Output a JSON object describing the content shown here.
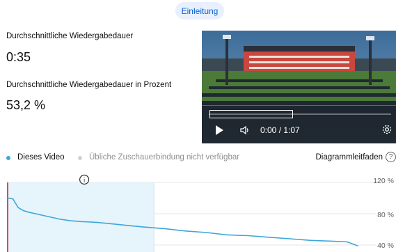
{
  "intro_chip": "Einleitung",
  "metrics": [
    {
      "label": "Durchschnittliche Wiedergabedauer",
      "value": "0:35"
    },
    {
      "label": "Durchschnittliche Wiedergabedauer in Prozent",
      "value": "53,2 %"
    }
  ],
  "player": {
    "time": "0:00 / 1:07",
    "progress": 0
  },
  "legend": {
    "this_video": "Dieses Video",
    "typical": "Übliche Zuschauerbindung nicht verfügbar",
    "guide": "Diagrammleitfaden",
    "help": "?",
    "colors": {
      "this_video": "#3ea6d9",
      "typical": "#d3d3d3"
    }
  },
  "info_glyph": "i",
  "chart_data": {
    "type": "line",
    "title": "",
    "xlabel": "",
    "ylabel": "",
    "y_ticks": [
      "120 %",
      "80 %",
      "40 %"
    ],
    "ylim": [
      0,
      120
    ],
    "x": [
      0,
      1,
      2,
      3,
      4,
      6,
      8,
      10,
      12,
      14,
      17,
      20,
      23,
      26,
      30,
      34,
      38,
      42,
      46,
      50,
      54,
      58,
      62,
      65,
      67
    ],
    "series": [
      {
        "values": [
          100,
          99,
          88,
          84,
          82,
          79,
          76,
          73,
          71,
          70,
          69,
          67,
          65,
          63,
          61,
          58,
          56,
          53,
          52,
          50,
          48,
          46,
          45,
          44,
          39
        ]
      }
    ],
    "highlight_range": [
      0,
      28
    ],
    "x_max": 67,
    "colors": {
      "line": "#3ea6d9",
      "highlight": "#e6f4fb",
      "marker": "#cc0000",
      "grid": "#e5e5e5"
    }
  }
}
